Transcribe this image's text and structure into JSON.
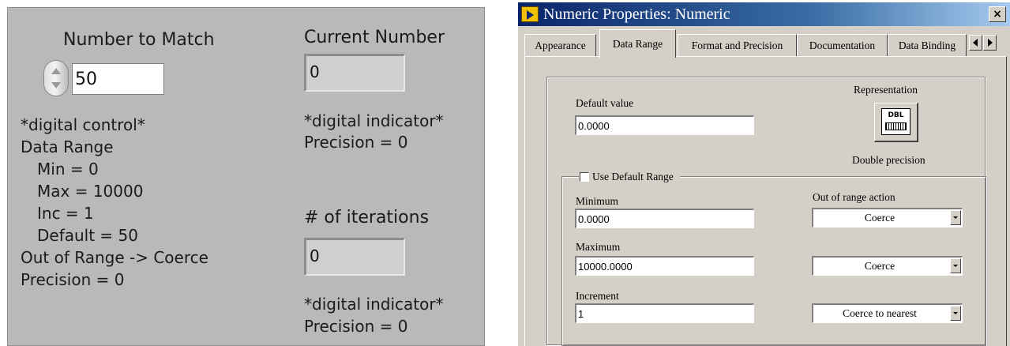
{
  "front_panel": {
    "control_label": "Number to Match",
    "control_value": "50",
    "control_notes": [
      "*digital control*",
      "Data Range",
      "Min = 0",
      "Max = 10000",
      "Inc = 1",
      "Default = 50",
      "Out of Range -> Coerce",
      "Precision = 0"
    ],
    "current_label": "Current Number",
    "current_value": "0",
    "current_notes": [
      "*digital indicator*",
      "Precision = 0"
    ],
    "iter_label": "# of iterations",
    "iter_value": "0",
    "iter_notes": [
      "*digital indicator*",
      "Precision = 0"
    ]
  },
  "dialog": {
    "title": "Numeric Properties: Numeric",
    "close_label": "×",
    "tabs": [
      "Appearance",
      "Data Range",
      "Format and Precision",
      "Documentation",
      "Data Binding"
    ],
    "active_tab": "Data Range",
    "default_value_label": "Default value",
    "default_value": "0.0000",
    "representation_label": "Representation",
    "representation_icon_text": "DBL",
    "representation_type": "Double precision",
    "use_default_range_label": "Use Default Range",
    "use_default_range_checked": false,
    "minimum_label": "Minimum",
    "minimum_value": "0.0000",
    "maximum_label": "Maximum",
    "maximum_value": "10000.0000",
    "increment_label": "Increment",
    "increment_value": "1",
    "out_of_range_label": "Out of range action",
    "min_action": "Coerce",
    "max_action": "Coerce",
    "inc_action": "Coerce to nearest"
  },
  "colors": {
    "panel_bg": "#b9b9bb",
    "dialog_bg": "#d4d0c8",
    "titlebar_start": "#0a246a",
    "titlebar_end": "#a6caf0"
  }
}
